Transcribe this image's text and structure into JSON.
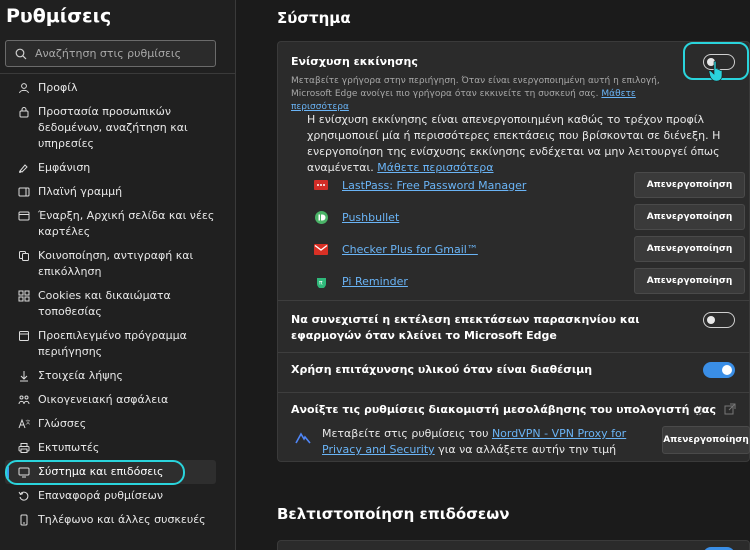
{
  "sidebar": {
    "title": "Ρυθμίσεις",
    "search_placeholder": "Αναζήτηση στις ρυθμίσεις",
    "items": [
      {
        "label": "Προφίλ",
        "icon": "profile-icon"
      },
      {
        "label": "Προστασία προσωπικών δεδομένων, αναζήτηση και υπηρεσίες",
        "icon": "lock-icon"
      },
      {
        "label": "Εμφάνιση",
        "icon": "appearance-icon"
      },
      {
        "label": "Πλαϊνή γραμμή",
        "icon": "sidebar-icon"
      },
      {
        "label": "Έναρξη, Αρχική σελίδα και νέες καρτέλες",
        "icon": "home-tabs-icon"
      },
      {
        "label": "Κοινοποίηση, αντιγραφή και επικόλληση",
        "icon": "share-icon"
      },
      {
        "label": "Cookies και δικαιώματα τοποθεσίας",
        "icon": "cookies-icon"
      },
      {
        "label": "Προεπιλεγμένο πρόγραμμα περιήγησης",
        "icon": "browser-icon"
      },
      {
        "label": "Στοιχεία λήψης",
        "icon": "download-icon"
      },
      {
        "label": "Οικογενειακή ασφάλεια",
        "icon": "family-icon"
      },
      {
        "label": "Γλώσσες",
        "icon": "languages-icon"
      },
      {
        "label": "Εκτυπωτές",
        "icon": "printer-icon"
      },
      {
        "label": "Σύστημα και επιδόσεις",
        "icon": "system-icon",
        "active": true
      },
      {
        "label": "Επαναφορά ρυθμίσεων",
        "icon": "reset-icon"
      },
      {
        "label": "Τηλέφωνο και άλλες συσκευές",
        "icon": "phone-icon"
      }
    ]
  },
  "main": {
    "heading": "Σύστημα",
    "startup_boost": {
      "title": "Ενίσχυση εκκίνησης",
      "desc": "Μεταβείτε γρήγορα στην περιήγηση. Όταν είναι ενεργοποιημένη αυτή η επιλογή, Microsoft Edge ανοίγει πιο γρήγορα όταν εκκινείτε τη συσκευή σας.",
      "learn_more": "Μάθετε περισσότερα",
      "toggle_on": false,
      "warning": "Η ενίσχυση εκκίνησης είναι απενεργοποιημένη καθώς το τρέχον προφίλ χρησιμοποιεί μία ή περισσότερες επεκτάσεις που βρίσκονται σε διένεξη. Η ενεργοποίηση της ενίσχυσης εκκίνησης ενδέχεται να μην λειτουργεί όπως αναμένεται.",
      "warning_link": "Μάθετε περισσότερα",
      "extensions": [
        {
          "name": "LastPass: Free Password Manager",
          "icon": "lastpass-icon",
          "color": "#d32d27"
        },
        {
          "name": "Pushbullet",
          "icon": "pushbullet-icon",
          "color": "#4ab367"
        },
        {
          "name": "Checker Plus for Gmail™",
          "icon": "gmail-checker-icon",
          "color": "#d93025"
        },
        {
          "name": "Pi Reminder",
          "icon": "pi-reminder-icon",
          "color": "#2fb87a"
        }
      ],
      "disable_label": "Απενεργοποίηση"
    },
    "background_apps": {
      "title": "Να συνεχιστεί η εκτέλεση επεκτάσεων παρασκηνίου και εφαρμογών όταν κλείνει το Microsoft Edge",
      "toggle_on": false
    },
    "hardware_accel": {
      "title": "Χρήση επιτάχυνσης υλικού όταν είναι διαθέσιμη",
      "toggle_on": true
    },
    "proxy": {
      "title": "Ανοίξτε τις ρυθμίσεις διακομιστή μεσολάβησης του υπολογιστή σας",
      "text_before": "Μεταβείτε στις ρυθμίσεις του",
      "link": "NordVPN - VPN Proxy for Privacy and Security",
      "text_after": "για να αλλάξετε αυτήν την τιμή",
      "disable_label": "Απενεργοποίηση"
    },
    "heading2": "Βελτιστοποίηση επιδόσεων"
  },
  "colors": {
    "accent": "#3a8ee6",
    "highlight_ring": "#2ad4dc",
    "link": "#6ab4f6"
  }
}
